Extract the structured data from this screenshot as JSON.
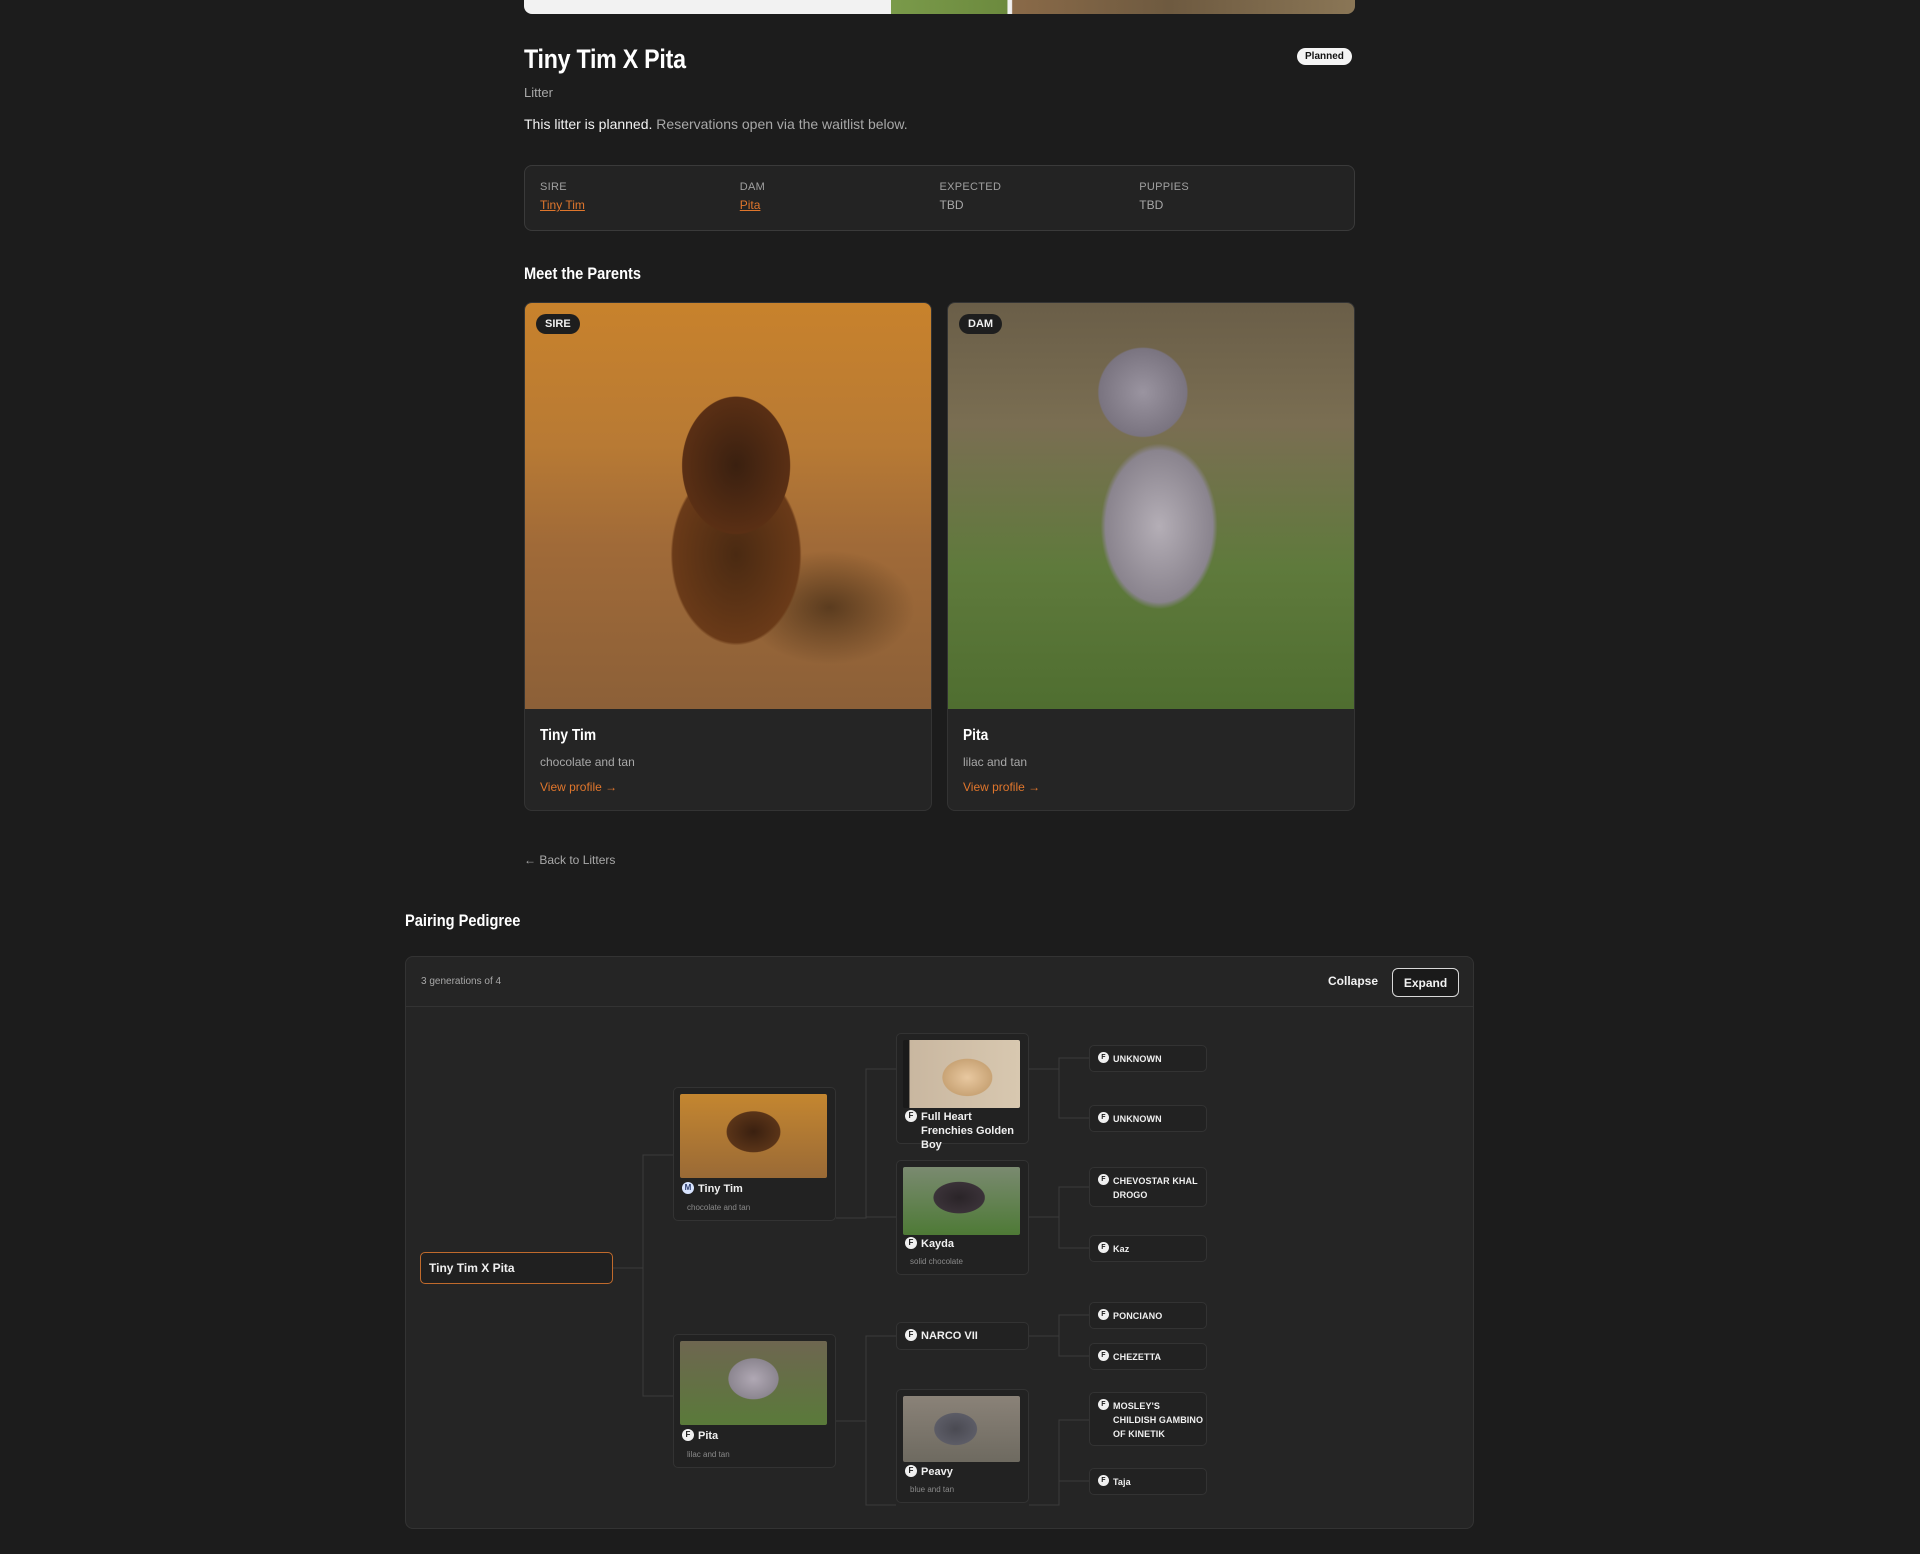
{
  "header": {
    "title": "Tiny Tim X Pita",
    "status": "Planned",
    "subtitle": "Litter",
    "planned_strong": "This litter is planned.",
    "planned_rest": " Reservations open via the waitlist below."
  },
  "info": {
    "sire_label": "SIRE",
    "sire_value": "Tiny Tim",
    "dam_label": "DAM",
    "dam_value": "Pita",
    "expected_label": "EXPECTED",
    "expected_value": "TBD",
    "puppies_label": "PUPPIES",
    "puppies_value": "TBD"
  },
  "parents_section": {
    "title": "Meet the Parents",
    "sire": {
      "tag": "SIRE",
      "name": "Tiny Tim",
      "color": "chocolate and tan",
      "link": "View profile →"
    },
    "dam": {
      "tag": "DAM",
      "name": "Pita",
      "color": "lilac and tan",
      "link": "View profile →"
    }
  },
  "back_link": "← Back to Litters",
  "pedigree": {
    "title": "Pairing Pedigree",
    "generations": "3 generations of 4",
    "collapse_label": "Collapse",
    "expand_label": "Expand",
    "root": "Tiny Tim X Pita",
    "gen1": [
      {
        "name": "Tiny Tim",
        "color": "chocolate and tan",
        "sex": "M"
      },
      {
        "name": "Pita",
        "color": "lilac and tan",
        "sex": "F"
      }
    ],
    "gen2": [
      {
        "name": "Full Heart Frenchies Golden Boy",
        "sex": "F"
      },
      {
        "name": "Kayda",
        "color": "solid chocolate",
        "sex": "F"
      },
      {
        "name": "NARCO VII",
        "sex": "F"
      },
      {
        "name": "Peavy",
        "color": "blue and tan",
        "sex": "F"
      }
    ],
    "gen3": [
      {
        "name": "UNKNOWN",
        "sex": "F"
      },
      {
        "name": "UNKNOWN",
        "sex": "F"
      },
      {
        "name": "CHEVOSTAR KHAL DROGO",
        "sex": "F"
      },
      {
        "name": "Kaz",
        "sex": "F"
      },
      {
        "name": "PONCIANO",
        "sex": "F"
      },
      {
        "name": "CHEZETTA",
        "sex": "F"
      },
      {
        "name": "MOSLEY'S CHILDISH GAMBINO OF KINETIK",
        "sex": "F"
      },
      {
        "name": "Taja",
        "sex": "F"
      }
    ]
  },
  "colors": {
    "accent": "#e0762c",
    "background": "#1c1c1c",
    "card": "#252525"
  }
}
